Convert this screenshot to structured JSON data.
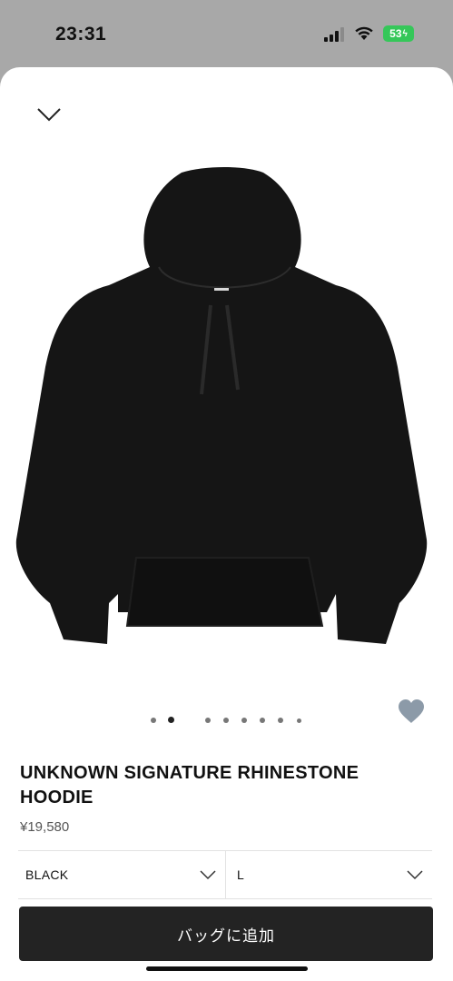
{
  "status": {
    "time": "23:31",
    "battery": "53"
  },
  "product": {
    "image_alt": "black hoodie",
    "title": "UNKNOWN SIGNATURE RHINESTONE HOODIE",
    "price": "¥19,580",
    "color": "BLACK",
    "size": "L",
    "color_hex": "#151515",
    "carousel": {
      "total": 8,
      "active_index": 1
    },
    "favorite_color": "#8c9aa8"
  },
  "actions": {
    "add_to_bag": "バッグに追加"
  }
}
